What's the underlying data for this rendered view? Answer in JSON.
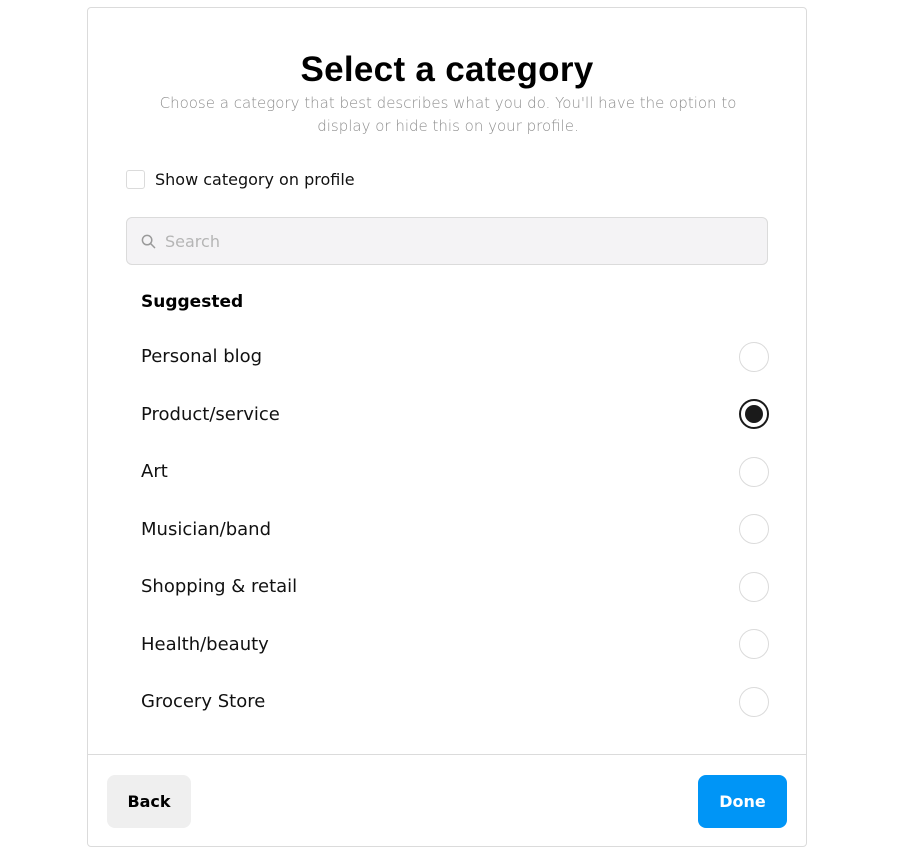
{
  "dialog": {
    "title": "Select a category",
    "subtitle": "Choose a category that best describes what you do. You'll have the option to display or hide this on your profile."
  },
  "show_category": {
    "label": "Show category on profile",
    "checked": false
  },
  "search": {
    "placeholder": "Search",
    "value": "",
    "icon": "search-icon"
  },
  "suggested": {
    "title": "Suggested",
    "options": [
      {
        "label": "Personal blog",
        "selected": false
      },
      {
        "label": "Product/service",
        "selected": true
      },
      {
        "label": "Art",
        "selected": false
      },
      {
        "label": "Musician/band",
        "selected": false
      },
      {
        "label": "Shopping & retail",
        "selected": false
      },
      {
        "label": "Health/beauty",
        "selected": false
      },
      {
        "label": "Grocery Store",
        "selected": false
      }
    ]
  },
  "footer": {
    "back_label": "Back",
    "done_label": "Done"
  },
  "colors": {
    "primary": "#0095f6",
    "secondary_button": "#efefef",
    "border": "#dbdbdb",
    "muted_text": "#8e8e8e"
  }
}
